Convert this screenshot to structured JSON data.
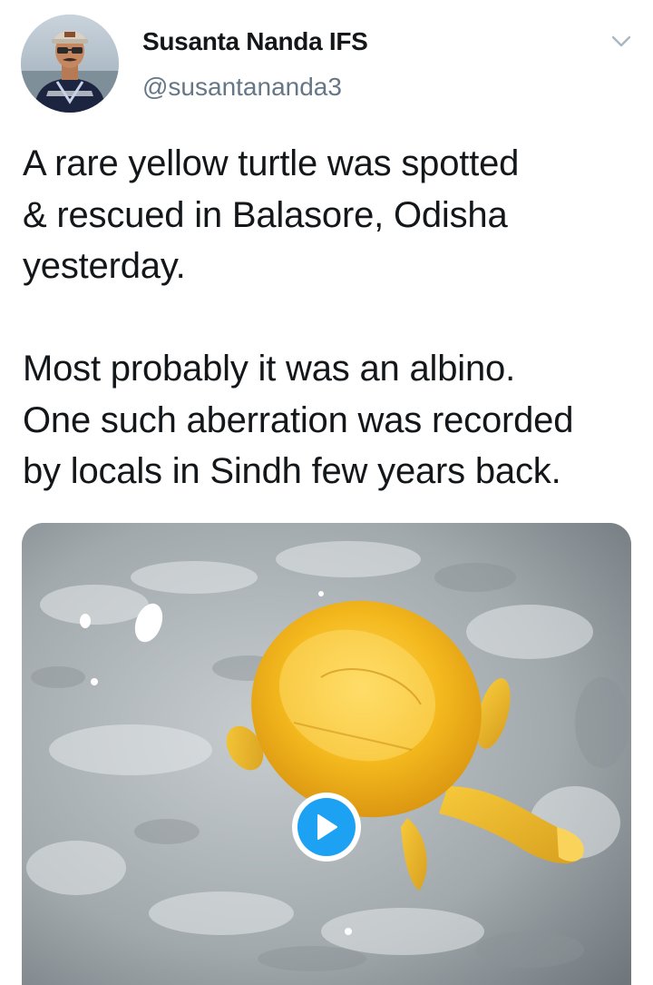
{
  "author": {
    "display_name": "Susanta Nanda IFS",
    "handle": "@susantananda3"
  },
  "tweet": {
    "text": "A rare yellow turtle was spotted\n& rescued in Balasore, Odisha\nyesterday.\n\nMost probably it was an albino.\nOne such aberration was recorded\nby locals in Sindh few years back."
  },
  "icons": {
    "menu": "chevron-down-icon",
    "media_action": "play-icon"
  },
  "colors": {
    "text_primary": "#14171a",
    "text_secondary": "#657786",
    "accent": "#1da1f2",
    "turtle": "#f2b81c"
  }
}
